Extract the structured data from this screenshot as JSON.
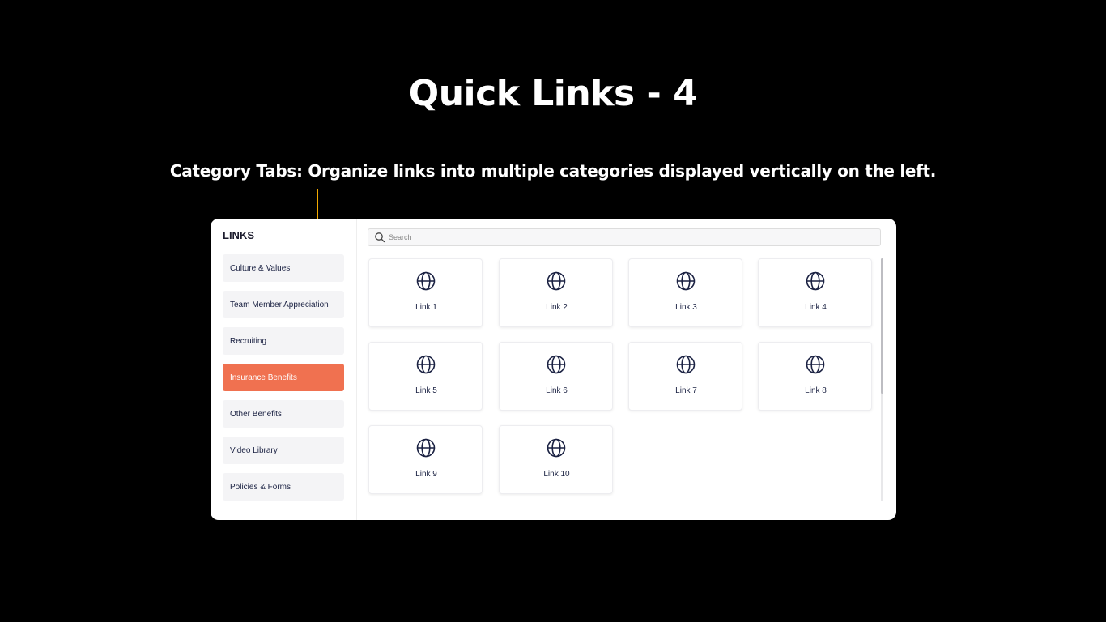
{
  "slide": {
    "title": "Quick Links - 4",
    "subtitle": "Category Tabs: Organize links into multiple categories displayed vertically on the left."
  },
  "colors": {
    "background": "#000000",
    "pointer": "#f2a900",
    "active_tab": "#f07150",
    "text_navy": "#1a2142"
  },
  "sidebar": {
    "heading": "LINKS",
    "active_index": 3,
    "tabs": [
      {
        "label": "Culture & Values"
      },
      {
        "label": "Team Member Appreciation"
      },
      {
        "label": "Recruiting"
      },
      {
        "label": "Insurance Benefits"
      },
      {
        "label": "Other Benefits"
      },
      {
        "label": "Video Library"
      },
      {
        "label": "Policies & Forms"
      }
    ]
  },
  "search": {
    "placeholder": "Search",
    "icon": "search-icon"
  },
  "links": {
    "icon": "globe-icon",
    "items": [
      {
        "label": "Link 1"
      },
      {
        "label": "Link 2"
      },
      {
        "label": "Link 3"
      },
      {
        "label": "Link 4"
      },
      {
        "label": "Link 5"
      },
      {
        "label": "Link 6"
      },
      {
        "label": "Link 7"
      },
      {
        "label": "Link 8"
      },
      {
        "label": "Link 9"
      },
      {
        "label": "Link 10"
      }
    ]
  }
}
